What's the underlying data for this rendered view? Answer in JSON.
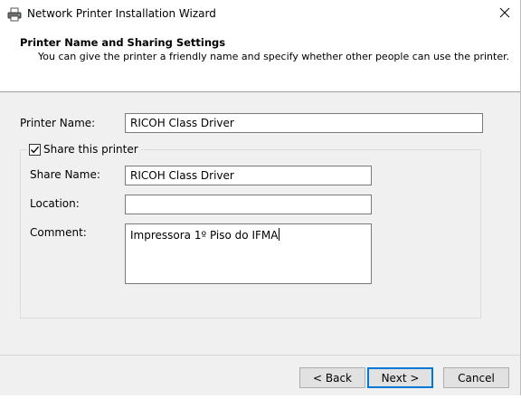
{
  "window": {
    "title": "Network Printer Installation Wizard",
    "icon": "printer-icon",
    "close_icon": "close-icon"
  },
  "header": {
    "title": "Printer Name and Sharing Settings",
    "subtitle": "You can give the printer a friendly name and specify whether other people can use the printer."
  },
  "form": {
    "printer_name_label": "Printer Name:",
    "printer_name_value": "RICOH Class Driver",
    "share_label": "Share this printer",
    "share_checked": true,
    "share_name_label": "Share Name:",
    "share_name_value": "RICOH Class Driver",
    "location_label": "Location:",
    "location_value": "",
    "comment_label": "Comment:",
    "comment_value": "Impressora 1º Piso do IFMA"
  },
  "buttons": {
    "back": "< Back",
    "next": "Next >",
    "cancel": "Cancel"
  },
  "colors": {
    "accent": "#0078d7",
    "dialog_bg": "#f0f0f0",
    "header_bg": "#ffffff"
  }
}
